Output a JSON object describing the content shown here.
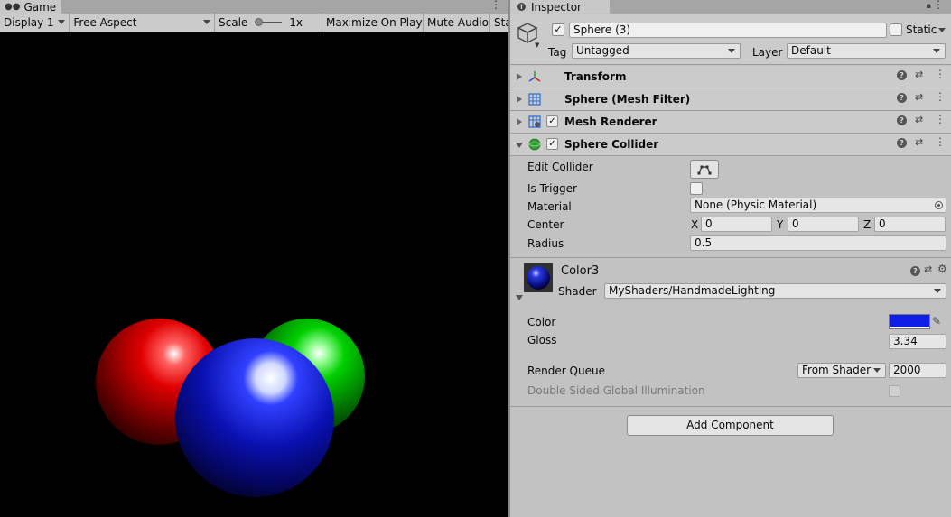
{
  "game": {
    "tab_label": "Game",
    "toolbar": {
      "display": "Display 1",
      "aspect": "Free Aspect",
      "scale_label": "Scale",
      "scale_value": "1x",
      "maximize": "Maximize On Play",
      "mute": "Mute Audio",
      "stats": "Stats"
    }
  },
  "inspector": {
    "tab_label": "Inspector",
    "object_name": "Sphere (3)",
    "static_label": "Static",
    "tag_label": "Tag",
    "tag_value": "Untagged",
    "layer_label": "Layer",
    "layer_value": "Default",
    "components": {
      "transform": "Transform",
      "mesh_filter": "Sphere (Mesh Filter)",
      "mesh_renderer": "Mesh Renderer",
      "sphere_collider": "Sphere Collider"
    },
    "collider": {
      "edit_collider": "Edit Collider",
      "is_trigger": "Is Trigger",
      "material_label": "Material",
      "material_value": "None (Physic Material)",
      "center_label": "Center",
      "x_label": "X",
      "x_value": "0",
      "y_label": "Y",
      "y_value": "0",
      "z_label": "Z",
      "z_value": "0",
      "radius_label": "Radius",
      "radius_value": "0.5"
    },
    "material": {
      "name": "Color3",
      "shader_label": "Shader",
      "shader_value": "MyShaders/HandmadeLighting",
      "color_label": "Color",
      "color_value": "#0d1fe6",
      "gloss_label": "Gloss",
      "gloss_value": "3.34",
      "render_queue_label": "Render Queue",
      "render_queue_mode": "From Shader",
      "render_queue_value": "2000",
      "dsgi_label": "Double Sided Global Illumination"
    },
    "add_component": "Add Component"
  }
}
